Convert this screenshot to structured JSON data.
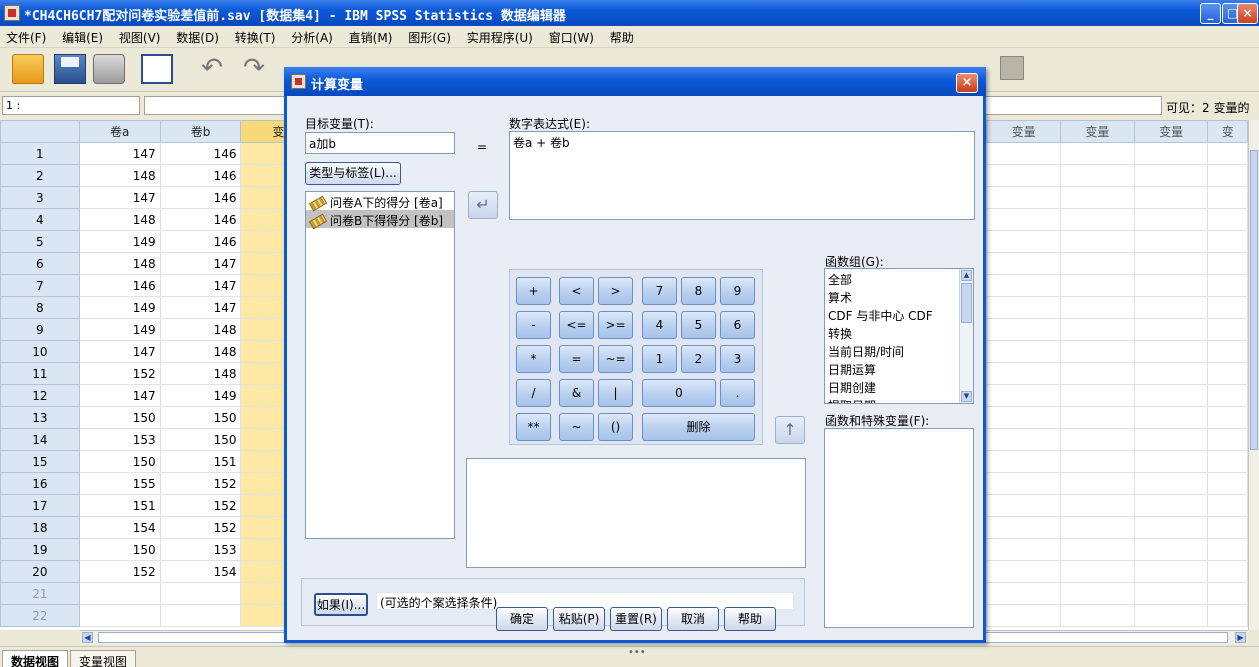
{
  "window": {
    "title": "*CH4CH6CH7配对问卷实验差值前.sav [数据集4] - IBM SPSS Statistics 数据编辑器",
    "minimize": "_",
    "maximize": "□",
    "close": "×"
  },
  "menu": [
    "文件(F)",
    "编辑(E)",
    "视图(V)",
    "数据(D)",
    "转换(T)",
    "分析(A)",
    "直销(M)",
    "图形(G)",
    "实用程序(U)",
    "窗口(W)",
    "帮助"
  ],
  "toolbar": {
    "undo": "↶",
    "redo": "↷"
  },
  "cellbar": {
    "ref": "1 :",
    "visible": "可见：2 变量的"
  },
  "grid": {
    "columns": [
      "卷a",
      "卷b",
      "变",
      "",
      "",
      "",
      "",
      "",
      "",
      "",
      "",
      "",
      "变量",
      "变量",
      "变量",
      "变"
    ],
    "rows": [
      [
        "1",
        "147",
        "146"
      ],
      [
        "2",
        "148",
        "146"
      ],
      [
        "3",
        "147",
        "146"
      ],
      [
        "4",
        "148",
        "146"
      ],
      [
        "5",
        "149",
        "146"
      ],
      [
        "6",
        "148",
        "147"
      ],
      [
        "7",
        "146",
        "147"
      ],
      [
        "8",
        "149",
        "147"
      ],
      [
        "9",
        "149",
        "148"
      ],
      [
        "10",
        "147",
        "148"
      ],
      [
        "11",
        "152",
        "148"
      ],
      [
        "12",
        "147",
        "149"
      ],
      [
        "13",
        "150",
        "150"
      ],
      [
        "14",
        "153",
        "150"
      ],
      [
        "15",
        "150",
        "151"
      ],
      [
        "16",
        "155",
        "152"
      ],
      [
        "17",
        "151",
        "152"
      ],
      [
        "18",
        "154",
        "152"
      ],
      [
        "19",
        "150",
        "153"
      ],
      [
        "20",
        "152",
        "154"
      ],
      [
        "21",
        "",
        ""
      ],
      [
        "22",
        "",
        ""
      ]
    ]
  },
  "tabs": {
    "data_view": "数据视图",
    "variable_view": "变量视图",
    "grip": "•••"
  },
  "dialog": {
    "title": "计算变量",
    "close": "×",
    "target_label": "目标变量(T):",
    "target_value": "a加b",
    "type_label_button": "类型与标签(L)...",
    "equals": "=",
    "expression_label": "数字表达式(E):",
    "expression_value": "卷a + 卷b",
    "variables": [
      {
        "label": "问卷A下的得分 [卷a]",
        "selected": false
      },
      {
        "label": "问卷B下得得分 [卷b]",
        "selected": true
      }
    ],
    "move_arrow": "↵",
    "up_arrow": "↑",
    "keypad": {
      "plus": "+",
      "lt": "<",
      "gt": ">",
      "seven": "7",
      "eight": "8",
      "nine": "9",
      "minus": "-",
      "le": "<=",
      "ge": ">=",
      "four": "4",
      "five": "5",
      "six": "6",
      "times": "*",
      "eq": "=",
      "ne": "~=",
      "one": "1",
      "two": "2",
      "three": "3",
      "divide": "/",
      "and": "&",
      "or": "|",
      "zero": "0",
      "dot": ".",
      "power": "**",
      "not": "~",
      "parens": "()",
      "delete": "删除"
    },
    "function_group_label": "函数组(G):",
    "function_groups": [
      "全部",
      "算术",
      "CDF 与非中心 CDF",
      "转换",
      "当前日期/时间",
      "日期运算",
      "日期创建",
      "提取日期"
    ],
    "functions_label": "函数和特殊变量(F):",
    "if_button": "如果(I)...",
    "if_hint": "(可选的个案选择条件)",
    "buttons": {
      "ok": "确定",
      "paste": "粘贴(P)",
      "reset": "重置(R)",
      "cancel": "取消",
      "help": "帮助"
    }
  }
}
